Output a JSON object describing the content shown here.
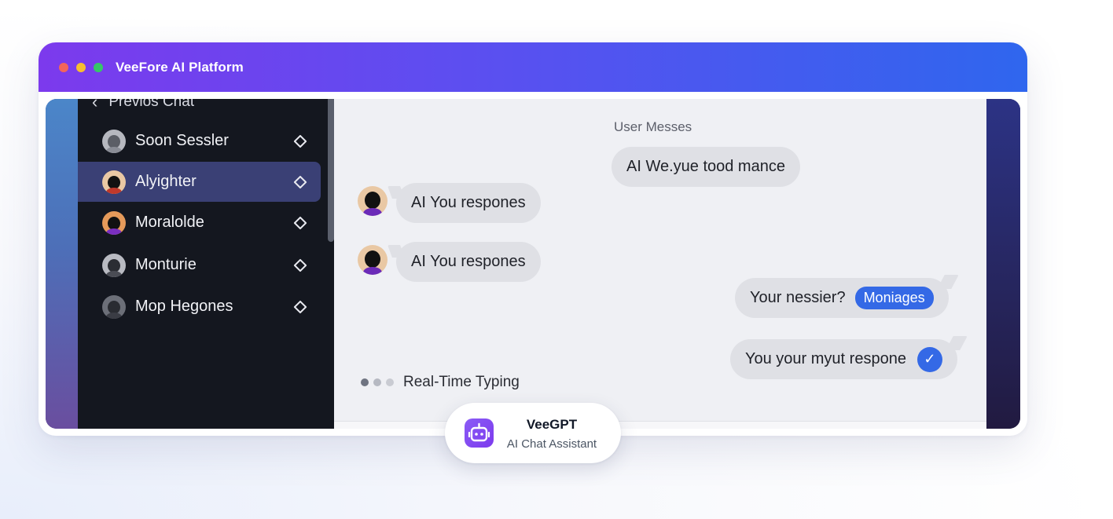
{
  "window": {
    "title": "VeeFore AI Platform"
  },
  "sidebar": {
    "back_label": "Previos Chat",
    "items": [
      {
        "label": "Soon Sessler",
        "avatar_color": "#8a8d96",
        "body_color": "#8a8d96"
      },
      {
        "label": "Alyighter",
        "avatar_color": "#e9c8a4",
        "body_color": "#c0392b"
      },
      {
        "label": "Moralolde",
        "avatar_color": "#e59a5a",
        "body_color": "#7a2fc0"
      },
      {
        "label": "Monturie",
        "avatar_color": "#b9bbc2",
        "body_color": "#2b2d33"
      },
      {
        "label": "Mop Hegones",
        "avatar_color": "#6c6f78",
        "body_color": "#3a3c44"
      }
    ],
    "active_index": 1
  },
  "chat": {
    "user_heading": "User Messes",
    "messages": [
      {
        "side": "right",
        "text": "AI We.yue tood mance"
      },
      {
        "side": "left",
        "text": "AI You respones"
      },
      {
        "side": "left",
        "text": "AI You respones"
      },
      {
        "side": "right",
        "text": "Your nessier?",
        "chip": "Moniages"
      },
      {
        "side": "right",
        "text": "You your myut respone",
        "status": "check"
      }
    ],
    "typing_label": "Real-Time Typing"
  },
  "badge": {
    "name": "VeeGPT",
    "subtitle": "AI Chat Assistant"
  },
  "colors": {
    "accent": "#3469e6",
    "header_start": "#7c3aed",
    "header_end": "#2f66ee",
    "sidebar_bg": "#14171f",
    "sidebar_active": "#3a4075"
  }
}
